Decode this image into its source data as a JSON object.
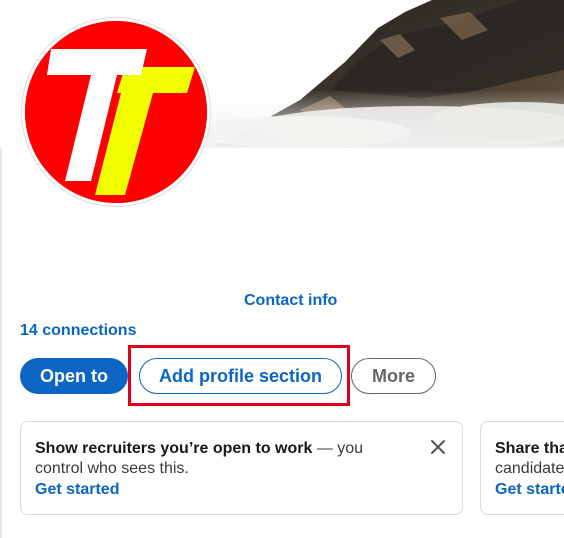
{
  "profile": {
    "contact_info": "Contact info",
    "connections": "14 connections"
  },
  "actions": {
    "open_to": "Open to",
    "add_profile_section": "Add profile section",
    "more": "More"
  },
  "cards": [
    {
      "title": "Show recruiters you’re open to work",
      "body": " — you control who sees this.",
      "link": "Get started"
    },
    {
      "title": "Share tha",
      "body": "candidate",
      "link": "Get starte"
    }
  ],
  "colors": {
    "brand_blue": "#0a66c2",
    "highlight_red": "#e0001a",
    "avatar_red": "#ff0000",
    "avatar_yellow": "#f2ff00"
  },
  "icons": {
    "dismiss": "close-icon"
  }
}
